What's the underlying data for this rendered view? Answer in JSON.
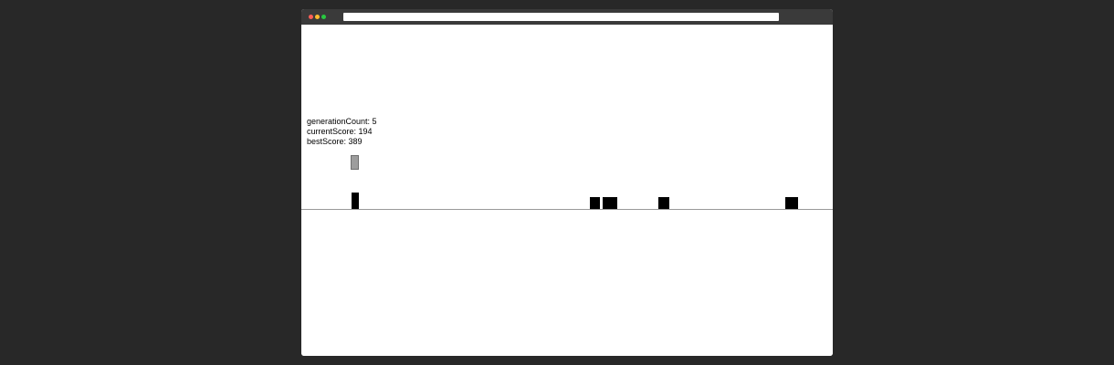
{
  "window": {
    "traffic_lights": [
      "#ff5f57",
      "#febc2e",
      "#28c840"
    ],
    "titlebar_color": "#3a3a3a"
  },
  "game": {
    "stats": {
      "generation_label": "generationCount: 5",
      "current_label": "currentScore: 194",
      "best_label": "bestScore: 389"
    },
    "colors": {
      "player": "#9d9d9d",
      "obstacle": "#000000",
      "ground": "#9a9a9a",
      "background": "#ffffff"
    }
  }
}
